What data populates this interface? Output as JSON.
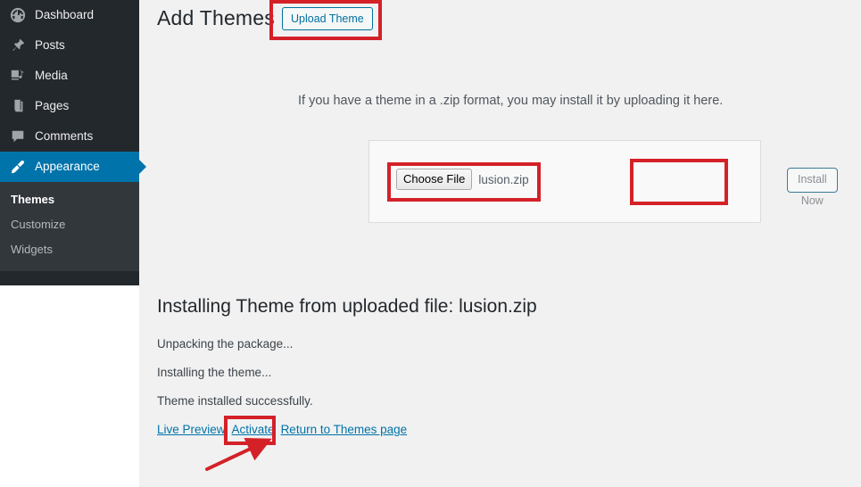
{
  "sidebar": {
    "items": [
      {
        "label": "Dashboard",
        "icon": "dashboard-icon",
        "current": false
      },
      {
        "label": "Posts",
        "icon": "pin-icon",
        "current": false
      },
      {
        "label": "Media",
        "icon": "media-icon",
        "current": false
      },
      {
        "label": "Pages",
        "icon": "pages-icon",
        "current": false
      },
      {
        "label": "Comments",
        "icon": "comment-icon",
        "current": false
      },
      {
        "label": "Appearance",
        "icon": "brush-icon",
        "current": true
      }
    ],
    "submenu": [
      {
        "label": "Themes",
        "current": true
      },
      {
        "label": "Customize",
        "current": false
      },
      {
        "label": "Widgets",
        "current": false
      }
    ],
    "colors": {
      "background": "#23282d",
      "submenu_background": "#32373c",
      "current_highlight": "#0073aa"
    }
  },
  "header": {
    "title": "Add Themes",
    "upload_theme_label": "Upload Theme"
  },
  "upload": {
    "help_text": "If you have a theme in a .zip format, you may install it by uploading it here.",
    "choose_file_label": "Choose File",
    "file_name": "lusion.zip",
    "install_now_label": "Install Now"
  },
  "install": {
    "title": "Installing Theme from uploaded file: lusion.zip",
    "log": [
      "Unpacking the package...",
      "Installing the theme...",
      "Theme installed successfully."
    ],
    "links": [
      {
        "label": "Live Preview"
      },
      {
        "label": "Activate"
      },
      {
        "label": "Return to Themes page"
      }
    ]
  },
  "annotations": {
    "highlight_color": "#d42128",
    "highlighted": [
      "Upload Theme",
      "Choose File",
      "Install Now",
      "Activate"
    ],
    "arrow_points_to": "Activate"
  }
}
